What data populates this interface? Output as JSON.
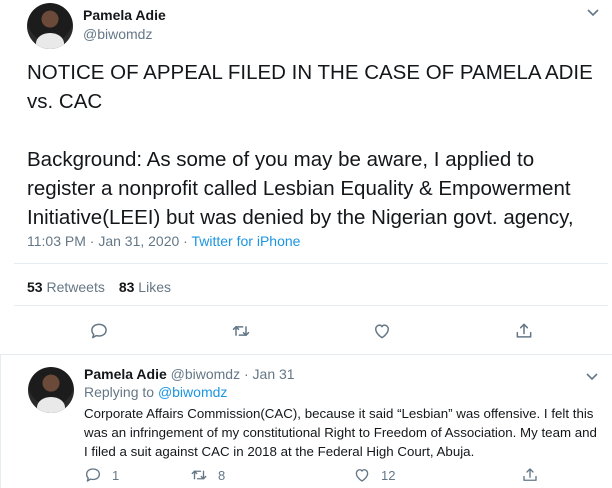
{
  "tweet": {
    "author_name": "Pamela Adie",
    "author_handle": "@biwomdz",
    "text": "NOTICE OF APPEAL FILED IN THE CASE OF PAMELA ADIE vs. CAC\n\nBackground: As some of you may be aware, I applied to register a nonprofit called Lesbian Equality & Empowerment Initiative(LEEI) but was denied by the Nigerian govt. agency,",
    "time": "11:03 PM · Jan 31, 2020 · ",
    "source": "Twitter for iPhone",
    "retweets_count": "53",
    "retweets_label": "Retweets",
    "likes_count": "83",
    "likes_label": "Likes",
    "menu_icon": "chevron-down-icon"
  },
  "reply": {
    "author_name": "Pamela Adie",
    "author_handle": "@biwomdz",
    "dot": "·",
    "date": "Jan 31",
    "replying_prefix": "Replying to ",
    "replying_handle": "@biwomdz",
    "text": "Corporate Affairs Commission(CAC), because it said “Lesbian” was offensive. I felt this was an infringement of my constitutional Right to Freedom of Association. My team and I filed a suit against CAC in 2018 at the Federal High Court, Abuja.",
    "reply_count": "1",
    "retweet_count": "8",
    "like_count": "12"
  },
  "colors": {
    "accent": "#1b95e0",
    "secondary_text": "#657786",
    "divider": "#e6ecf0"
  }
}
